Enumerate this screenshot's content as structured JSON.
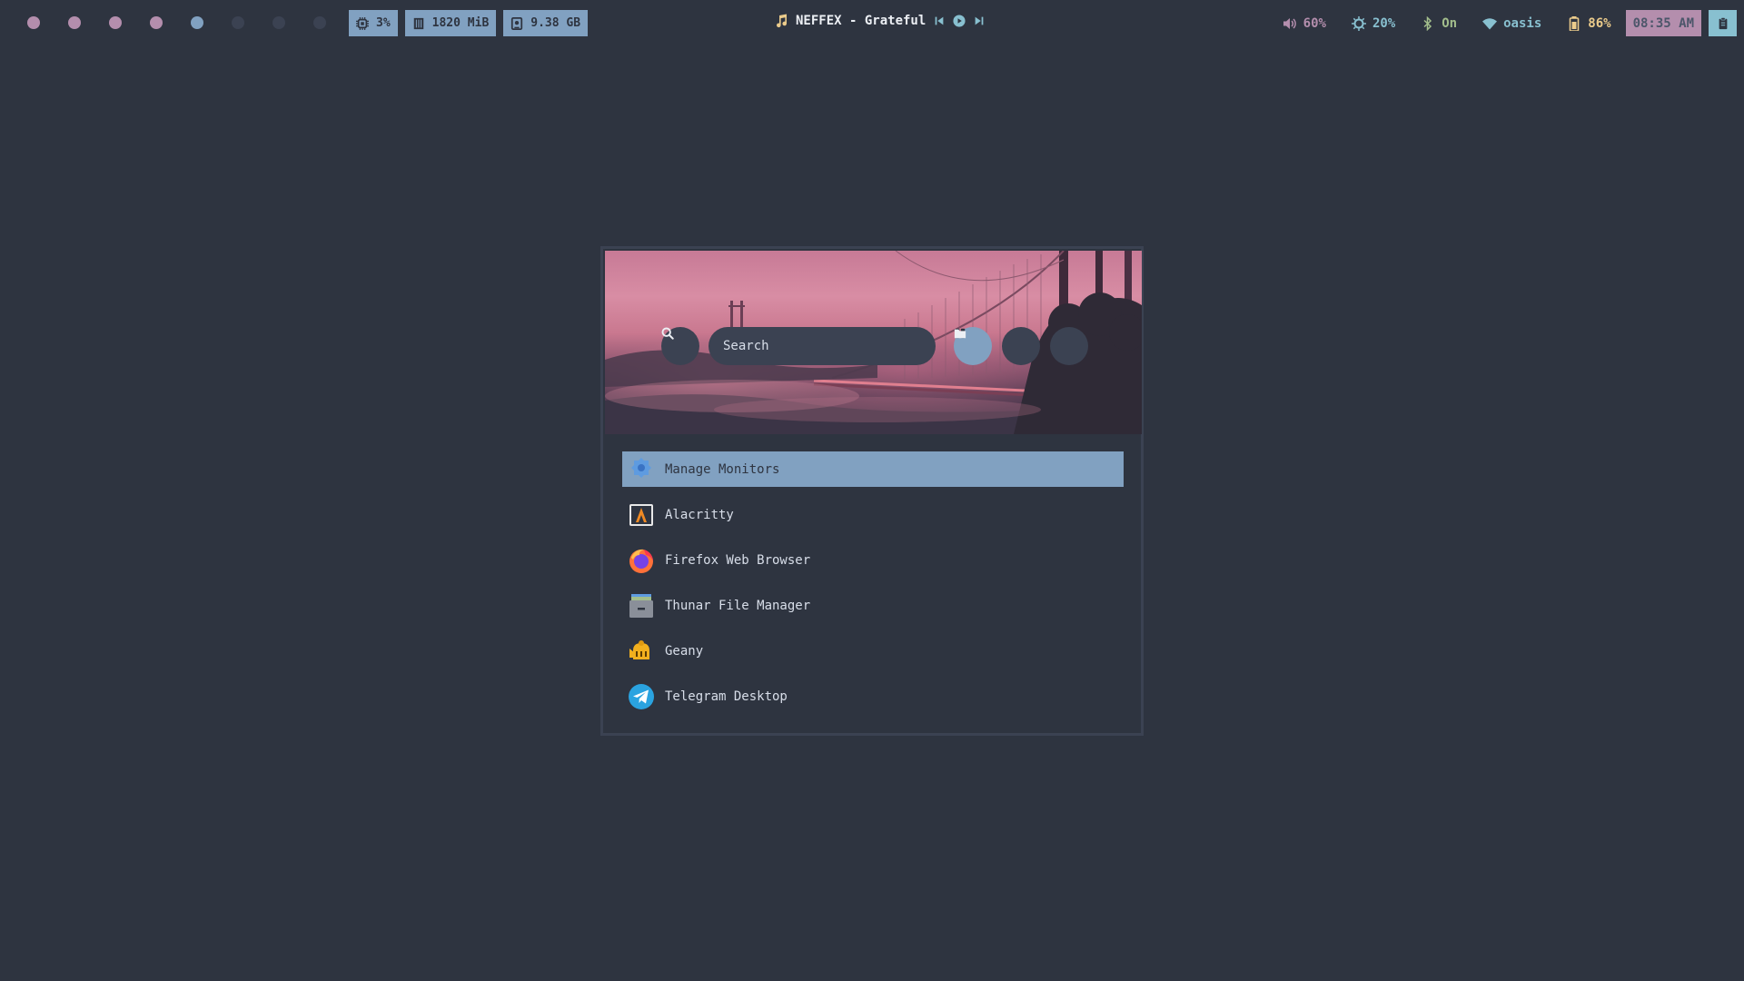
{
  "workspaces": {
    "dots": [
      {
        "color": "#b48ead"
      },
      {
        "color": "#b48ead"
      },
      {
        "color": "#b48ead"
      },
      {
        "color": "#b48ead"
      },
      {
        "color": "#81a1c1"
      },
      {
        "color": "#3b4252"
      },
      {
        "color": "#3b4252"
      },
      {
        "color": "#3b4252"
      }
    ]
  },
  "modules": {
    "cpu": {
      "icon": "cpu-icon",
      "value": "3%"
    },
    "memory": {
      "icon": "memory-icon",
      "value": "1820 MiB"
    },
    "disk": {
      "icon": "disk-icon",
      "value": "9.38 GB"
    }
  },
  "media": {
    "icon": "music-note-icon",
    "track": "NEFFEX - Grateful",
    "prev_icon": "skip-previous-icon",
    "play_icon": "play-icon",
    "next_icon": "skip-next-icon"
  },
  "status": {
    "volume": {
      "icon": "volume-icon",
      "value": "60%",
      "color": "#b48ead"
    },
    "brightness": {
      "icon": "brightness-icon",
      "value": "20%",
      "color": "#88c0d0"
    },
    "bluetooth": {
      "icon": "bluetooth-icon",
      "value": "On",
      "color": "#a3be8c"
    },
    "wifi": {
      "icon": "wifi-icon",
      "value": "oasis",
      "color": "#88c0d0"
    },
    "battery": {
      "icon": "battery-icon",
      "value": "86%",
      "color": "#ebcb8b"
    },
    "clock": "08:35 AM",
    "clipboard_icon": "clipboard-icon"
  },
  "launcher": {
    "search": {
      "placeholder": "Search",
      "value": ""
    },
    "modes": [
      "apps-grid-icon",
      "terminal-icon",
      "folder-icon"
    ],
    "items": [
      {
        "label": "Manage Monitors",
        "icon": "monitor-settings-icon",
        "selected": true
      },
      {
        "label": "Alacritty",
        "icon": "alacritty-icon",
        "selected": false
      },
      {
        "label": "Firefox Web Browser",
        "icon": "firefox-icon",
        "selected": false
      },
      {
        "label": "Thunar File Manager",
        "icon": "file-manager-icon",
        "selected": false
      },
      {
        "label": "Geany",
        "icon": "geany-icon",
        "selected": false
      },
      {
        "label": "Telegram Desktop",
        "icon": "telegram-icon",
        "selected": false
      }
    ]
  }
}
